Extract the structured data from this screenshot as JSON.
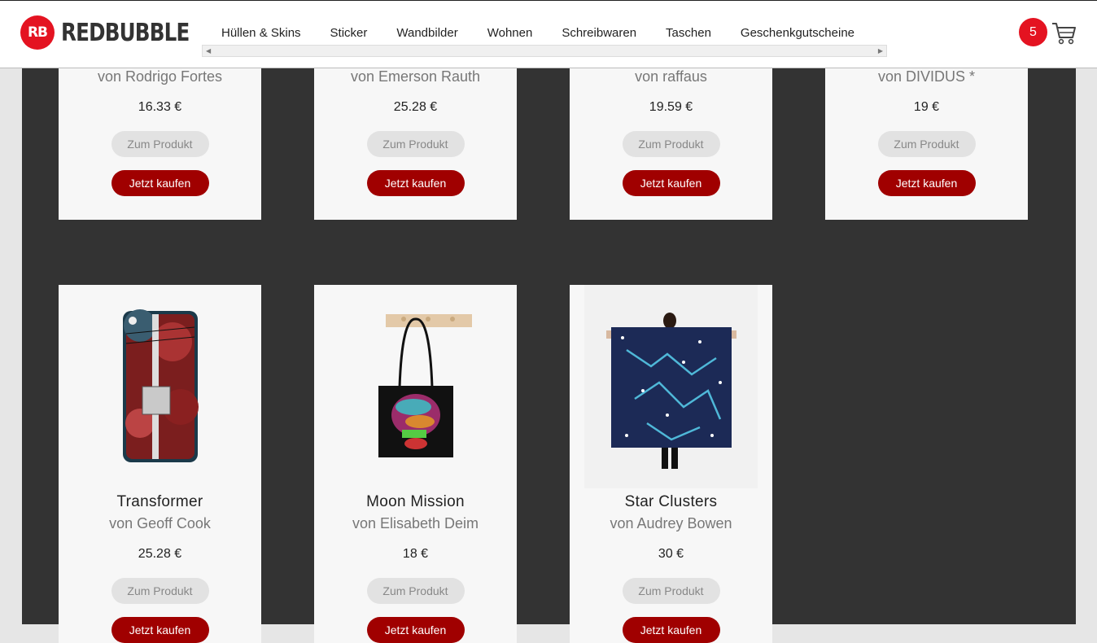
{
  "header": {
    "logo_mark": "RB",
    "logo_text": "REDBUBBLE",
    "nav": [
      "Hüllen & Skins",
      "Sticker",
      "Wandbilder",
      "Wohnen",
      "Schreibwaren",
      "Taschen",
      "Geschenkgutscheine"
    ],
    "cart_count": "5",
    "cart_icon": "cart-icon"
  },
  "buttons": {
    "view": "Zum Produkt",
    "buy": "Jetzt kaufen"
  },
  "top_row": [
    {
      "artist": "von Rodrigo Fortes",
      "price": "16.33 €"
    },
    {
      "artist": "von Emerson Rauth",
      "price": "25.28 €"
    },
    {
      "artist": "von raffaus",
      "price": "19.59 €"
    },
    {
      "artist": "von DIVIDUS *",
      "price": "19 €"
    }
  ],
  "bottom_row": [
    {
      "title": "Transformer",
      "artist": "von Geoff Cook",
      "price": "25.28 €"
    },
    {
      "title": "Moon Mission",
      "artist": "von Elisabeth Deim",
      "price": "18 €"
    },
    {
      "title": "Star Clusters",
      "artist": "von Audrey Bowen",
      "price": "30 €"
    }
  ],
  "colors": {
    "brand_red": "#e41321",
    "buy_button": "#a00000",
    "panel": "#333333"
  }
}
